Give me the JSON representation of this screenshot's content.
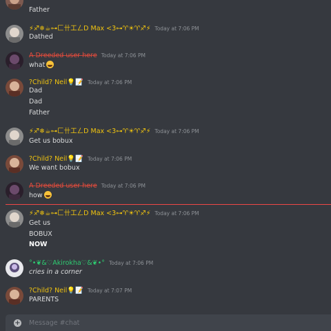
{
  "colors": {
    "background": "#36393f",
    "timestamp": "#8e9297",
    "new_divider": "#f04747",
    "author_max": "#f1c40f",
    "author_red": "#e74c3c",
    "author_neil": "#f1c40f",
    "author_akiro": "#2ecc71"
  },
  "messages": [
    {
      "author": "",
      "timestamp": "",
      "lines": [
        "Father"
      ]
    },
    {
      "author": "⚡♐❄☕⊶匚卄工ㄥD Max <3⊶♈☀♈♐⚡",
      "timestamp": "Today at 7:06 PM",
      "lines": [
        "Dathed"
      ]
    },
    {
      "author": "A̶ ̶D̶r̶e̶e̶d̶e̶d̶ ̶u̶s̶e̶r̶ ̶h̶e̶r̶e̶",
      "timestamp": "Today at 7:06 PM",
      "lines": [
        "what"
      ]
    },
    {
      "author": "?Child? Neil💡📝",
      "timestamp": "Today at 7:06 PM",
      "lines": [
        "Dad",
        "Dad",
        "Father"
      ]
    },
    {
      "author": "⚡♐❄☕⊶匚卄工ㄥD Max <3⊶♈☀♈♐⚡",
      "timestamp": "Today at 7:06 PM",
      "lines": [
        "Get us bobux"
      ]
    },
    {
      "author": "?Child? Neil💡📝",
      "timestamp": "Today at 7:06 PM",
      "lines": [
        "We want bobux"
      ]
    },
    {
      "author": "A̶ ̶D̶r̶e̶e̶d̶e̶d̶ ̶u̶s̶e̶r̶ ̶h̶e̶r̶e̶",
      "timestamp": "Today at 7:06 PM",
      "lines": [
        "how"
      ]
    },
    {
      "author": "⚡♐❄☕⊶匚卄工ㄥD Max <3⊶♈☀♈♐⚡",
      "timestamp": "Today at 7:06 PM",
      "lines": [
        "Get us",
        "BOBUX",
        "NOW"
      ]
    },
    {
      "author": "°•❦&♡Akirokha♡&❦•°",
      "timestamp": "Today at 7:06 PM",
      "lines": [
        "cries in a corner"
      ]
    },
    {
      "author": "?Child? Neil💡📝",
      "timestamp": "Today at 7:07 PM",
      "lines": [
        "PARENTS"
      ]
    }
  ],
  "composer": {
    "placeholder": "Message #chat",
    "add_icon": "plus-icon"
  }
}
